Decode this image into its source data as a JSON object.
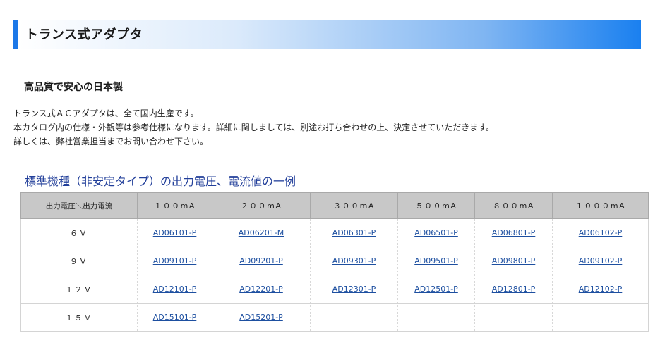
{
  "header": {
    "title": "トランス式アダプタ"
  },
  "section": {
    "heading": "高品質で安心の日本製"
  },
  "intro": {
    "lines": [
      "トランス式ＡＣアダプタは、全て国内生産です。",
      "本カタログ内の仕様・外観等は参考仕様になります。詳細に関しましては、別途お打ち合わせの上、決定させていただきます。",
      "詳しくは、弊社営業担当までお問い合わせ下さい。"
    ]
  },
  "spec_table": {
    "title": "標準機種（非安定タイプ）の出力電圧、電流値の一例",
    "corner_header": "出力電圧＼出力電流",
    "columns": [
      "１００mA",
      "２００mA",
      "３００mA",
      "５００mA",
      "８００mA",
      "１０００mA"
    ],
    "rows": [
      {
        "voltage": "６Ｖ",
        "cells": [
          "AD06101-P",
          "AD06201-M",
          "AD06301-P",
          "AD06501-P",
          "AD06801-P",
          "AD06102-P"
        ]
      },
      {
        "voltage": "９Ｖ",
        "cells": [
          "AD09101-P",
          "AD09201-P",
          "AD09301-P",
          "AD09501-P",
          "AD09801-P",
          "AD09102-P"
        ]
      },
      {
        "voltage": "１２Ｖ",
        "cells": [
          "AD12101-P",
          "AD12201-P",
          "AD12301-P",
          "AD12501-P",
          "AD12801-P",
          "AD12102-P"
        ]
      },
      {
        "voltage": "１５Ｖ",
        "cells": [
          "AD15101-P",
          "AD15201-P",
          "",
          "",
          "",
          ""
        ]
      }
    ]
  },
  "colors": {
    "title_bar_accent": "#1c78e8",
    "link": "#1d4fa0",
    "table_title": "#223f9a",
    "table_header_bg": "#c8c8c8"
  }
}
